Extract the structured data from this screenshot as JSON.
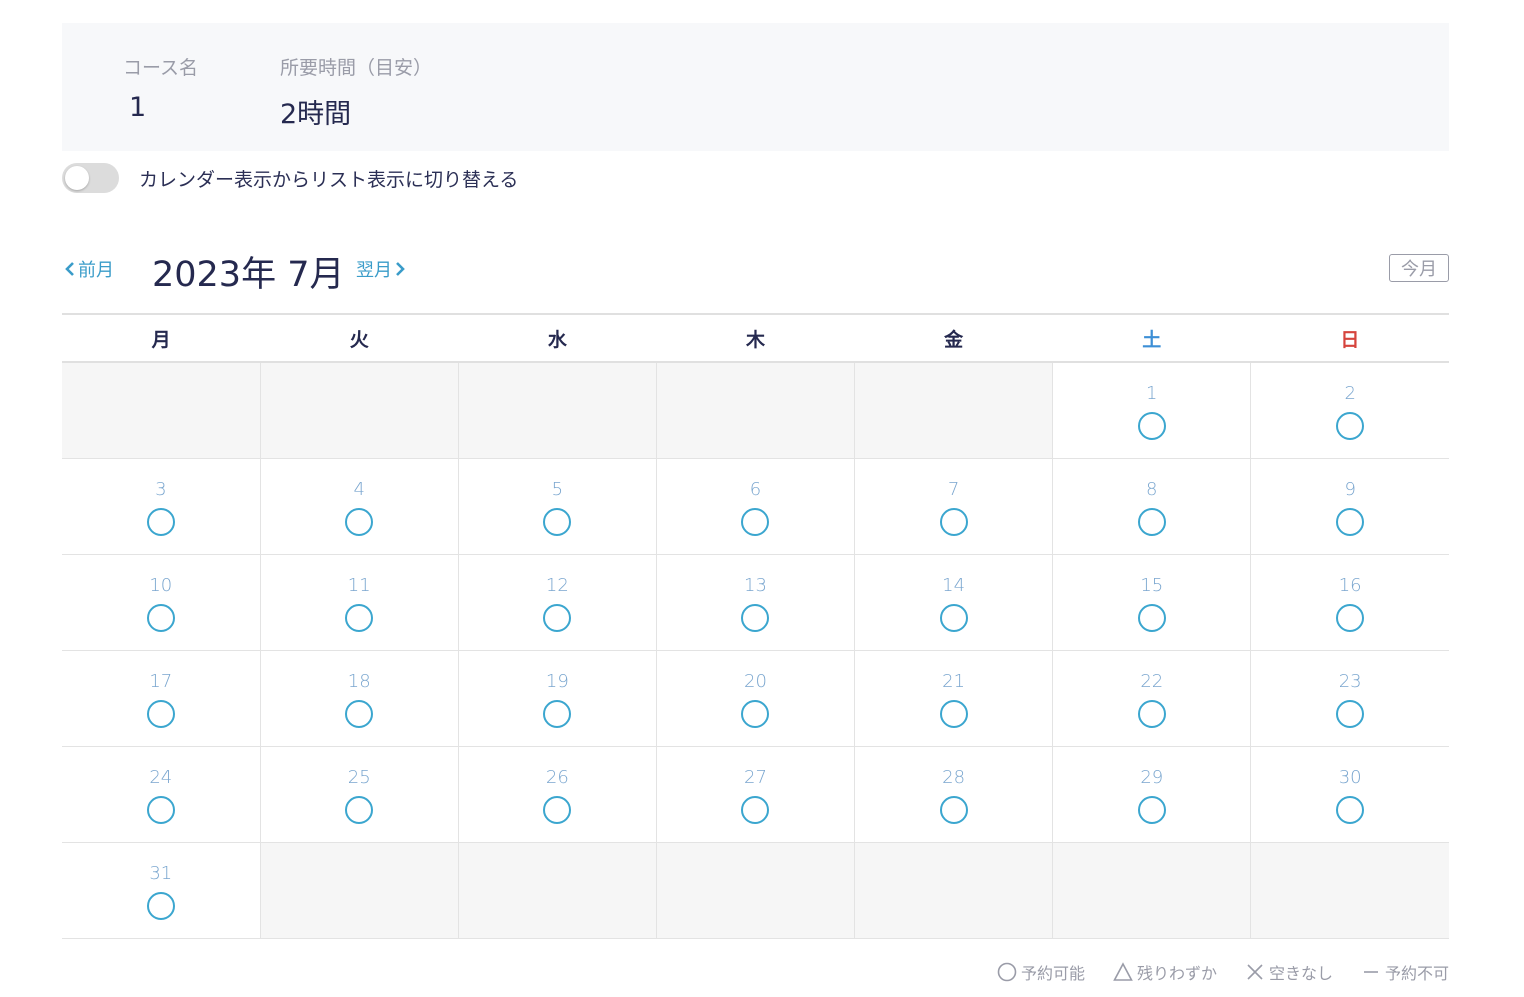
{
  "course": {
    "name_label": "コース名",
    "name_value": "1",
    "time_label": "所要時間（目安）",
    "time_value": "2時間"
  },
  "toggle": {
    "label": "カレンダー表示からリスト表示に切り替える"
  },
  "nav": {
    "prev_label": "前月",
    "next_label": "翌月",
    "month_title": "2023年 7月",
    "today_label": "今月"
  },
  "weekdays": [
    "月",
    "火",
    "水",
    "木",
    "金",
    "土",
    "日"
  ],
  "calendar": {
    "leading_empty": 5,
    "days": [
      "1",
      "2",
      "3",
      "4",
      "5",
      "6",
      "7",
      "8",
      "9",
      "10",
      "11",
      "12",
      "13",
      "14",
      "15",
      "16",
      "17",
      "18",
      "19",
      "20",
      "21",
      "22",
      "23",
      "24",
      "25",
      "26",
      "27",
      "28",
      "29",
      "30",
      "31"
    ],
    "status": "available",
    "trailing_empty": 6
  },
  "legend": {
    "available": "予約可能",
    "few_left": "残りわずか",
    "full": "空きなし",
    "unavailable": "予約不可"
  },
  "colors": {
    "accent": "#3ba6cf",
    "saturday": "#3d8fd6",
    "sunday": "#d6443d",
    "text": "#25294f"
  }
}
